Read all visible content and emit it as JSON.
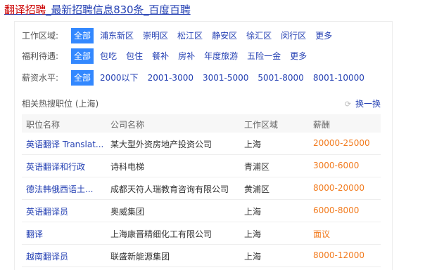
{
  "result_title": {
    "part1": "翻译招聘",
    "part2": "_最新招聘信息830条_百度百聘"
  },
  "filters": [
    {
      "label": "工作区域:",
      "options": [
        "全部",
        "浦东新区",
        "崇明区",
        "松江区",
        "静安区",
        "徐汇区",
        "闵行区",
        "更多"
      ],
      "active_index": 0
    },
    {
      "label": "福利待遇:",
      "options": [
        "全部",
        "包吃",
        "包住",
        "餐补",
        "房补",
        "年度旅游",
        "五险一金",
        "更多"
      ],
      "active_index": 0
    },
    {
      "label": "薪资水平:",
      "options": [
        "全部",
        "2000以下",
        "2001-3000",
        "3001-5000",
        "5001-8000",
        "8001-10000"
      ],
      "active_index": 0
    }
  ],
  "hot_jobs": {
    "title": "相关热搜职位 (上海)",
    "refresh_label": "换一换",
    "refresh_icon": "refresh-icon",
    "columns": [
      "职位名称",
      "公司名称",
      "工作区域",
      "薪酬"
    ],
    "rows": [
      [
        "英语翻译 Translat...",
        "某大型外资房地产投资公司",
        "上海",
        "20000-25000"
      ],
      [
        "英语翻译和行政",
        "诗科电梯",
        "青浦区",
        "3000-6000"
      ],
      [
        "德法韩俄西语土...",
        "成都天符人瑞教育咨询有限公司",
        "黄浦区",
        "8000-20000"
      ],
      [
        "英语翻译员",
        "奥威集团",
        "上海",
        "6000-8000"
      ],
      [
        "翻译",
        "上海康晋精细化工有限公司",
        "上海",
        "面议"
      ],
      [
        "越南翻译员",
        "联盛新能源集团",
        "上海",
        "8000-12000"
      ]
    ]
  },
  "colors": {
    "link": "#2440b3",
    "highlight": "#cc0000",
    "active_bg": "#3388ff",
    "salary": "#f27b1e"
  }
}
